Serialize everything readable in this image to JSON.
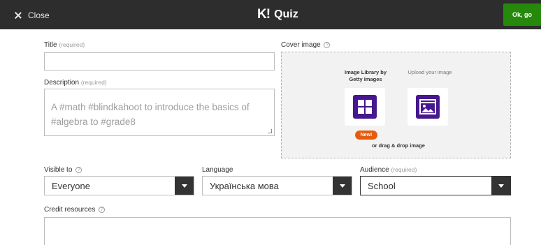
{
  "topbar": {
    "close_label": "Close",
    "logo": "K!",
    "app_name": "Quiz",
    "ok_label": "Ok, go"
  },
  "form": {
    "title": {
      "label": "Title",
      "hint": "(required)",
      "value": ""
    },
    "description": {
      "label": "Description",
      "hint": "(required)",
      "placeholder": "A #math #blindkahoot to introduce the basics of #algebra to #grade8"
    },
    "cover": {
      "label": "Cover image",
      "library_title": "Image Library by Getty Images",
      "upload_title": "Upload your image",
      "new_badge": "New!",
      "drag_drop": "or drag & drop image"
    },
    "visible_to": {
      "label": "Visible to",
      "value": "Everyone"
    },
    "language": {
      "label": "Language",
      "value": "Українська мова"
    },
    "audience": {
      "label": "Audience",
      "hint": "(required)",
      "value": "School"
    },
    "credit": {
      "label": "Credit resources",
      "value": ""
    }
  },
  "colors": {
    "topbar": "#2d2d2d",
    "ok_button": "#26890c",
    "tile_purple": "#46178f",
    "new_badge": "#e85a0c",
    "select_arrow_bg": "#333333"
  },
  "icons": {
    "close": "close-icon",
    "library": "grid-icon",
    "upload": "image-upload-icon",
    "help": "help-circle-icon",
    "dropdown": "caret-down-icon"
  }
}
